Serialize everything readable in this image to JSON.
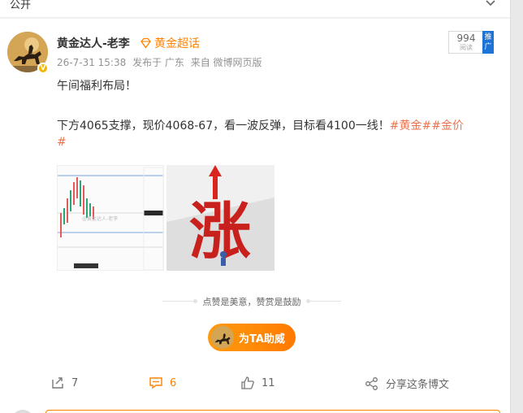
{
  "topbar": {
    "visibility": "公开",
    "chevron_icon": "chevron-down-icon"
  },
  "post": {
    "author": "黄金达人-老李",
    "super_tag": "黄金超话",
    "meta": {
      "date": "26-7-31 15:38",
      "published_in": "发布于 广东",
      "source": "来自 微博网页版"
    },
    "reads": {
      "count": "994",
      "label": "阅读"
    },
    "promo": "推广",
    "line1": "午间福利布局！",
    "line2": "下方4065支撑，现价4068-67，看一波反弹，目标看4100一线！",
    "tag1": "#黄金#",
    "tag2_part1": "#金价",
    "tag2_part2": "#",
    "images": [
      {
        "icon": "candlestick-chart-image",
        "watermark": "@黄金达人-老李"
      },
      {
        "icon": "rise-character-image",
        "character": "涨"
      }
    ]
  },
  "reward": {
    "text": "点赞是美意，赞赏是鼓励",
    "button": "为TA助威"
  },
  "actions": {
    "repost": {
      "icon": "repost-icon",
      "count": "7"
    },
    "comment": {
      "icon": "comment-icon",
      "count": "6"
    },
    "like": {
      "icon": "thumbs-up-icon",
      "count": "11"
    },
    "share": {
      "icon": "share-icon",
      "label": "分享这条博文"
    }
  },
  "colors": {
    "accent": "#ff8200",
    "tag": "#eb7350",
    "promo": "#1e73d6"
  }
}
